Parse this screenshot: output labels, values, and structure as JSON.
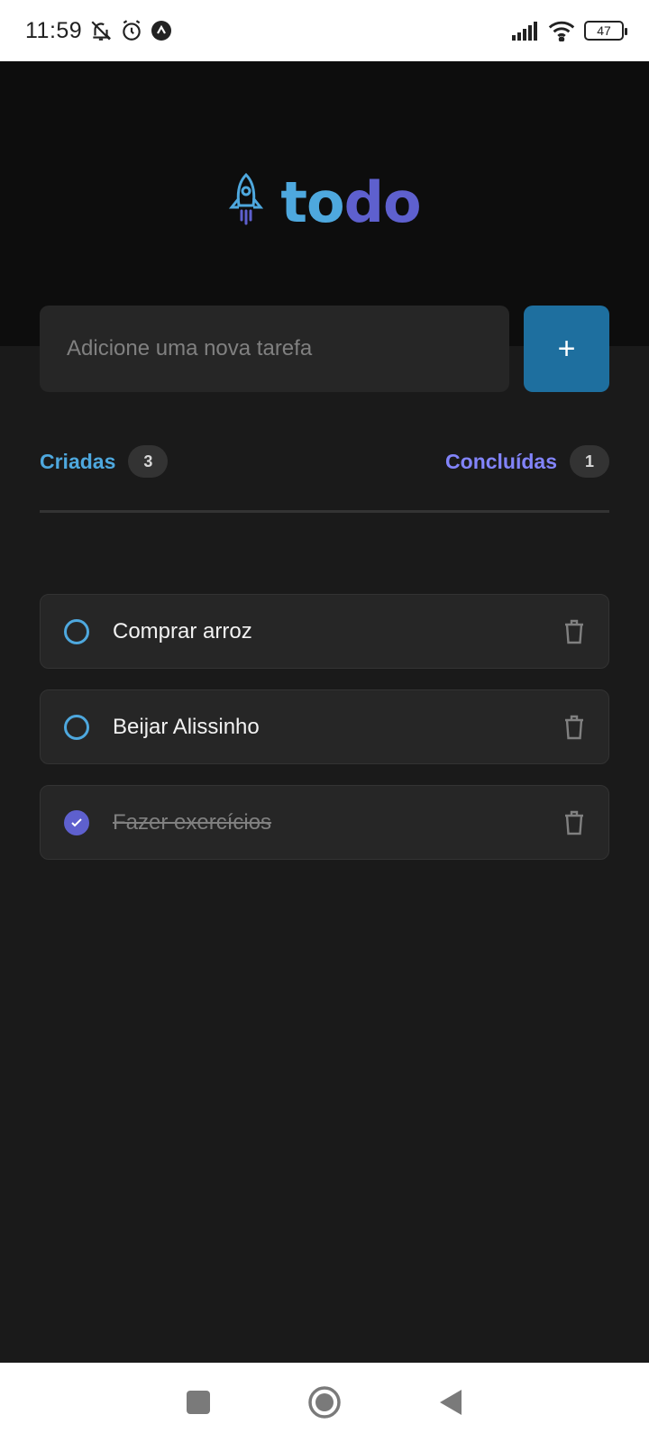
{
  "status_bar": {
    "time": "11:59",
    "battery": "47",
    "icons": [
      "bell-off-icon",
      "alarm-icon",
      "app-notification-icon",
      "signal-icon",
      "wifi-icon",
      "battery-icon"
    ]
  },
  "header": {
    "logo_icon": "rocket-icon",
    "logo_part1": "to",
    "logo_part2": "do"
  },
  "new_task": {
    "placeholder": "Adicione uma nova tarefa",
    "value": "",
    "add_label": "+"
  },
  "counters": {
    "created_label": "Criadas",
    "created_count": "3",
    "done_label": "Concluídas",
    "done_count": "1"
  },
  "tasks": [
    {
      "text": "Comprar arroz",
      "done": false
    },
    {
      "text": "Beijar Alissinho",
      "done": false
    },
    {
      "text": "Fazer exercícios",
      "done": true
    }
  ],
  "colors": {
    "blue": "#4ea8de",
    "purple": "#5e60ce",
    "purple_light": "#8284fa",
    "button": "#1e6f9f",
    "background": "#1a1a1a",
    "header_bg": "#0d0d0d"
  },
  "nav_bar": {
    "icons": [
      "recent-apps-icon",
      "home-icon",
      "back-icon"
    ]
  }
}
